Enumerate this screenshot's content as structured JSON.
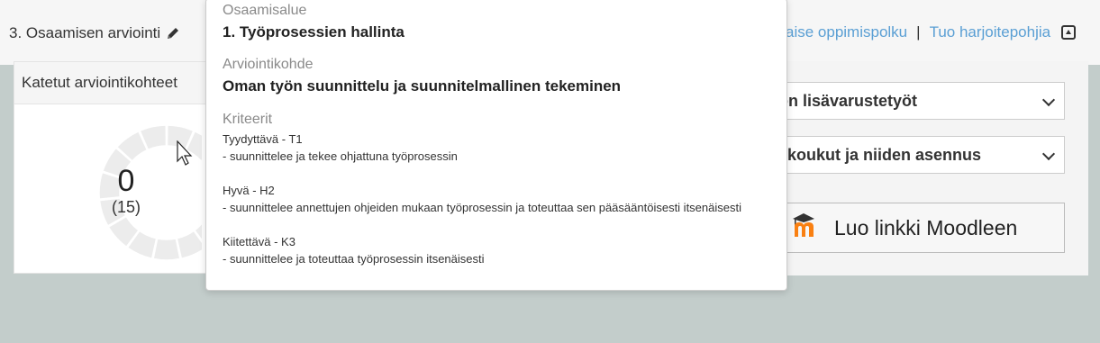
{
  "header": {
    "section_title": "3. Osaamisen arviointi",
    "link_path": "aise oppimispolku",
    "separator": "|",
    "link_templates": "Tuo harjoitepohjia"
  },
  "left_panel": {
    "title": "Katetut arviointikohteet",
    "donut_value": "0",
    "donut_total": "(15)"
  },
  "right_panel": {
    "select_1": "on lisävarustetyöt",
    "select_2": "kkoukut ja niiden asennus",
    "moodle_button": "Luo linkki Moodleen"
  },
  "popover": {
    "label_area": "Osaamisalue",
    "area_value": "1. Työprosessien hallinta",
    "label_target": "Arviointikohde",
    "target_value": "Oman työn suunnittelu ja suunnitelmallinen tekeminen",
    "label_criteria": "Kriteerit",
    "criteria": [
      {
        "level": "Tyydyttävä - T1",
        "text": "- suunnittelee ja tekee ohjattuna työprosessin"
      },
      {
        "level": "Hyvä - H2",
        "text": "- suunnittelee annettujen ohjeiden mukaan työprosessin ja toteuttaa sen pääsääntöisesti itsenäisesti"
      },
      {
        "level": "Kiitettävä - K3",
        "text": "- suunnittelee ja toteuttaa työprosessin itsenäisesti"
      }
    ]
  },
  "colors": {
    "background": "#c3cdcb",
    "link": "#5a9fd4",
    "moodle_orange": "#f98012"
  },
  "icons": [
    "pencil-icon",
    "collapse-icon",
    "chevron-down-icon",
    "moodle-logo-icon",
    "mouse-cursor-icon"
  ]
}
